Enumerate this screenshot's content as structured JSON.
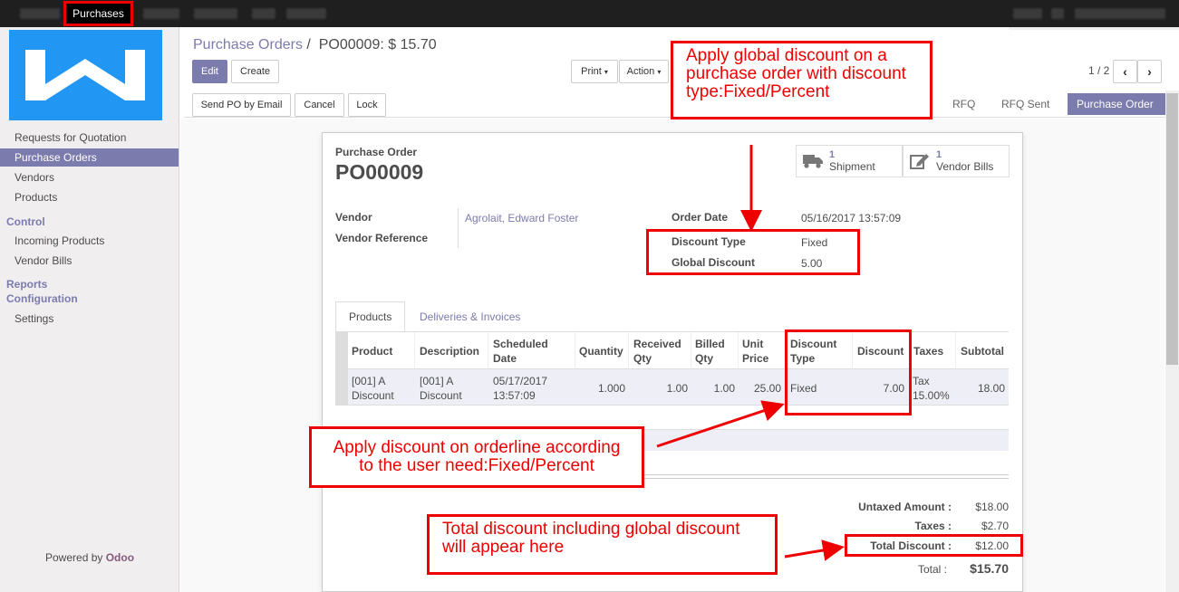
{
  "navbar": {
    "active_app": "Purchases"
  },
  "sidebar": {
    "items": [
      {
        "label": "Requests for Quotation",
        "active": false
      },
      {
        "label": "Purchase Orders",
        "active": true
      },
      {
        "label": "Vendors",
        "active": false
      },
      {
        "label": "Products",
        "active": false
      }
    ],
    "control_header": "Control",
    "control_items": [
      {
        "label": "Incoming Products"
      },
      {
        "label": "Vendor Bills"
      }
    ],
    "reports_header": "Reports",
    "config_header": "Configuration",
    "config_items": [
      {
        "label": "Settings"
      }
    ],
    "powered_prefix": "Powered by",
    "powered_brand": "Odoo"
  },
  "breadcrumb": {
    "parent": "Purchase Orders",
    "separator": "/",
    "current": "PO00009: $ 15.70"
  },
  "buttons": {
    "edit": "Edit",
    "create": "Create",
    "print": "Print",
    "action": "Action",
    "send_po": "Send PO by Email",
    "cancel": "Cancel",
    "lock": "Lock"
  },
  "pager": {
    "text": "1 / 2"
  },
  "stages": [
    {
      "label": "RFQ",
      "current": false
    },
    {
      "label": "RFQ Sent",
      "current": false
    },
    {
      "label": "Purchase Order",
      "current": true
    }
  ],
  "form": {
    "doc_type": "Purchase Order",
    "name": "PO00009",
    "smart_buttons": [
      {
        "count": "1",
        "label": "Shipment",
        "icon": "truck-icon"
      },
      {
        "count": "1",
        "label": "Vendor Bills",
        "icon": "pencil-square-icon"
      }
    ],
    "vendor_label": "Vendor",
    "vendor_value": "Agrolait, Edward Foster",
    "vendor_ref_label": "Vendor Reference",
    "order_date_label": "Order Date",
    "order_date_value": "05/16/2017 13:57:09",
    "discount_type_label": "Discount Type",
    "discount_type_value": "Fixed",
    "global_discount_label": "Global Discount",
    "global_discount_value": "5.00"
  },
  "tabs": [
    {
      "label": "Products",
      "active": true
    },
    {
      "label": "Deliveries & Invoices",
      "active": false
    }
  ],
  "order_lines": {
    "columns": [
      "Product",
      "Description",
      "Scheduled Date",
      "Quantity",
      "Received Qty",
      "Billed Qty",
      "Unit Price",
      "Discount Type",
      "Discount",
      "Taxes",
      "Subtotal"
    ],
    "rows": [
      {
        "product": "[001] A Discount",
        "description": "[001] A Discount",
        "scheduled_date": "05/17/2017 13:57:09",
        "quantity": "1.000",
        "received": "1.00",
        "billed": "1.00",
        "unit_price": "25.00",
        "discount_type": "Fixed",
        "discount": "7.00",
        "taxes": "Tax 15.00%",
        "subtotal": "18.00"
      }
    ]
  },
  "totals": {
    "untaxed_label": "Untaxed Amount :",
    "untaxed_value": "$18.00",
    "taxes_label": "Taxes :",
    "taxes_value": "$2.70",
    "discount_label": "Total Discount :",
    "discount_value": "$12.00",
    "total_label": "Total :",
    "total_value": "$15.70"
  },
  "annotations": {
    "global": "Apply global discount on a purchase order with discount type:Fixed/Percent",
    "orderline": "Apply discount on orderline according to the user need:Fixed/Percent",
    "total": "Total discount including global discount will appear here"
  },
  "colors": {
    "accent": "#7c7bad",
    "annotation_red": "#ee0000",
    "logo_blue": "#2196f3"
  }
}
